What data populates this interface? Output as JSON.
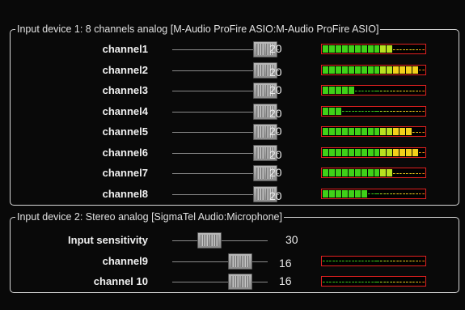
{
  "groups": [
    {
      "title": "Input device 1: 8 channels analog [M-Audio ProFire ASIO:M-Audio ProFire ASIO]",
      "rows": [
        {
          "label": "channel1",
          "value": "20",
          "slider_level": 0.98,
          "meter_level": 11
        },
        {
          "label": "channel2",
          "value": "20",
          "slider_level": 0.98,
          "meter_level": 15
        },
        {
          "label": "channel3",
          "value": "20",
          "slider_level": 0.98,
          "meter_level": 5
        },
        {
          "label": "channel4",
          "value": "20",
          "slider_level": 0.98,
          "meter_level": 3
        },
        {
          "label": "channel5",
          "value": "20",
          "slider_level": 0.98,
          "meter_level": 14
        },
        {
          "label": "channel6",
          "value": "20",
          "slider_level": 0.98,
          "meter_level": 15
        },
        {
          "label": "channel7",
          "value": "20",
          "slider_level": 0.98,
          "meter_level": 11
        },
        {
          "label": "channel8",
          "value": "20",
          "slider_level": 0.98,
          "meter_level": 7
        }
      ]
    },
    {
      "title": "Input device 2: Stereo analog [SigmaTel Audio:Microphone]",
      "rows": [
        {
          "label": "Input sensitivity",
          "value": "30",
          "slider_level": 0.35,
          "meter_level": null
        },
        {
          "label": "channel9",
          "value": "16",
          "slider_level": 0.78,
          "meter_level": 0
        },
        {
          "label": "channel 10",
          "value": "16",
          "slider_level": 0.78,
          "meter_level": 0
        }
      ]
    }
  ],
  "meter_segments": 16,
  "colors": {
    "green": "#3fd118",
    "yellow_green": "#b8e020",
    "yellow": "#f2d01a",
    "orange": "#f08a10",
    "red": "#e02020",
    "border": "#d8d8d8"
  }
}
